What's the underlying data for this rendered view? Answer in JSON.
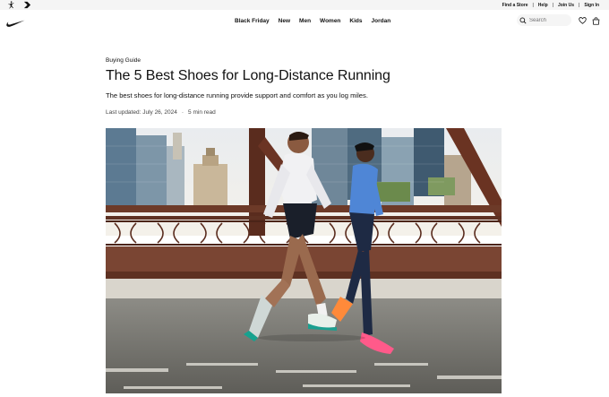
{
  "utility_bar": {
    "brands": [
      "jordan-jumpman-icon",
      "converse-chevron-icon"
    ],
    "links": [
      "Find a Store",
      "Help",
      "Join Us",
      "Sign In"
    ]
  },
  "nav": {
    "logo": "nike-swoosh-icon",
    "menu": [
      "Black Friday",
      "New",
      "Men",
      "Women",
      "Kids",
      "Jordan"
    ],
    "search_placeholder": "Search",
    "icons": [
      "search-icon",
      "heart-icon",
      "bag-icon"
    ]
  },
  "article": {
    "kicker": "Buying Guide",
    "title": "The 5 Best Shoes for Long-Distance Running",
    "dek": "The best shoes for long-distance running provide support and comfort as you log miles.",
    "updated": "Last updated: July 26, 2024",
    "read_time": "5 min read"
  },
  "colors": {
    "utility_bg": "#f5f5f5",
    "text": "#111111",
    "muted": "#707072"
  }
}
